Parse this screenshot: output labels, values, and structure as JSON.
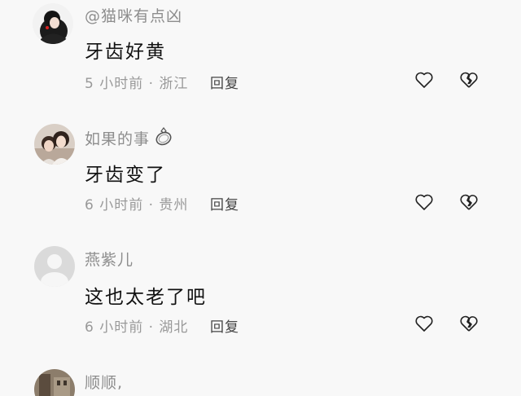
{
  "comments": [
    {
      "username": "@猫咪有点凶",
      "text": "牙齿好黄",
      "meta": "5 小时前 · 浙江",
      "reply_label": "回复",
      "avatar": "avatar-girl-dark-hair"
    },
    {
      "username": "如果的事",
      "text": "牙齿变了",
      "meta": "6 小时前 · 贵州",
      "reply_label": "回复",
      "avatar": "avatar-two-women-photo",
      "badge": "ring-icon"
    },
    {
      "username": "燕紫儿",
      "text": "这也太老了吧",
      "meta": "6 小时前 · 湖北",
      "reply_label": "回复",
      "avatar": "avatar-default-gray"
    },
    {
      "username": "顺顺,",
      "avatar": "avatar-photo-building"
    }
  ],
  "icons": {
    "like": "heart-outline-icon",
    "dislike": "broken-heart-outline-icon"
  },
  "colors": {
    "background": "#f8f8f8",
    "username": "#8d8d8d",
    "text": "#111111",
    "meta": "#999999",
    "reply": "#444444"
  }
}
